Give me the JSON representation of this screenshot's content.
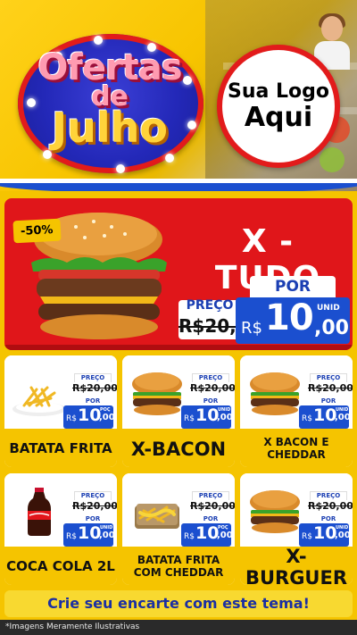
{
  "header": {
    "title_line1": "Ofertas",
    "title_line2": "de",
    "title_line3": "Julho",
    "logo_line1": "Sua Logo",
    "logo_line2": "Aqui"
  },
  "colors": {
    "brand_yellow": "#f5c400",
    "brand_red": "#e0161a",
    "brand_blue": "#1b4fcf"
  },
  "featured": {
    "discount": "-50%",
    "name": "X - TUDO",
    "preco_label": "PREÇO",
    "old_price": "R$20,00",
    "por_label": "POR",
    "currency": "R$",
    "price_main": "10",
    "price_cents": ",00",
    "unit": "UNID"
  },
  "products": [
    {
      "name": "BATATA FRITA",
      "preco_label": "PREÇO",
      "old_price": "R$20,00",
      "por_label": "POR",
      "currency": "R$",
      "price_main": "10",
      "price_cents": ",00",
      "unit": "POÇ",
      "icon": "fries-icon"
    },
    {
      "name": "X-BACON",
      "preco_label": "PREÇO",
      "old_price": "R$20,00",
      "por_label": "POR",
      "currency": "R$",
      "price_main": "10",
      "price_cents": ",00",
      "unit": "UNID",
      "icon": "burger-icon"
    },
    {
      "name": "X BACON E CHEDDAR",
      "preco_label": "PREÇO",
      "old_price": "R$20,00",
      "por_label": "POR",
      "currency": "R$",
      "price_main": "10",
      "price_cents": ",00",
      "unit": "UNID",
      "icon": "burger-icon"
    },
    {
      "name": "COCA COLA 2L",
      "preco_label": "PREÇO",
      "old_price": "R$20,00",
      "por_label": "POR",
      "currency": "R$",
      "price_main": "10",
      "price_cents": ",00",
      "unit": "UNID",
      "icon": "soda-bottle-icon"
    },
    {
      "name": "BATATA FRITA COM CHEDDAR",
      "preco_label": "PREÇO",
      "old_price": "R$20,00",
      "por_label": "POR",
      "currency": "R$",
      "price_main": "10",
      "price_cents": ",00",
      "unit": "POÇ",
      "icon": "fries-cheddar-icon"
    },
    {
      "name": "X-BURGUER",
      "preco_label": "PREÇO",
      "old_price": "R$20,00",
      "por_label": "POR",
      "currency": "R$",
      "price_main": "10",
      "price_cents": ",00",
      "unit": "UNID",
      "icon": "burger-icon"
    }
  ],
  "footer": {
    "cta": "Crie seu encarte com este tema!",
    "disclaimer": "*Imagens Meramente Ilustrativas"
  }
}
